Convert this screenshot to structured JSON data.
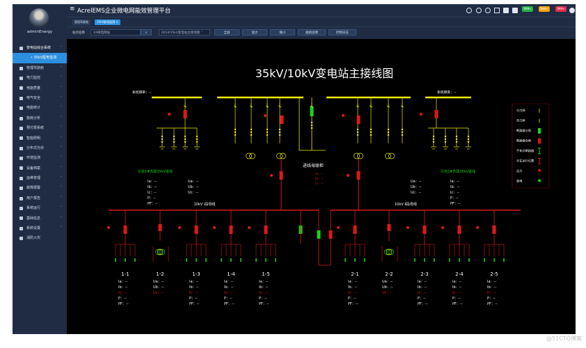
{
  "user": {
    "name": "adminEnergy"
  },
  "header": {
    "title": "AcrelEMS企业微电网能效管理平台",
    "badges": [
      "999+",
      "999+",
      "999+"
    ]
  },
  "tabs": [
    {
      "label": "管理驾驶舱"
    },
    {
      "label": "35kV配电监测"
    }
  ],
  "toolbar": {
    "site_label": "站点名称",
    "site_value": "XX微电网站",
    "diagram_select": "001#35kV变电站主接线图",
    "buttons": [
      "全屏",
      "放大",
      "缩小",
      "规则说明",
      "控制日志"
    ]
  },
  "sidebar": {
    "items": [
      {
        "label": "变电站综合系统",
        "open": true
      },
      {
        "label": "35kV配电监测",
        "sub": true
      },
      {
        "label": "管理驾驶舱"
      },
      {
        "label": "电力监控"
      },
      {
        "label": "电能质量"
      },
      {
        "label": "电气安全"
      },
      {
        "label": "电能统计"
      },
      {
        "label": "能耗分析"
      },
      {
        "label": "预付费系统"
      },
      {
        "label": "智能照明"
      },
      {
        "label": "分布式光伏"
      },
      {
        "label": "环境监测"
      },
      {
        "label": "设备档案"
      },
      {
        "label": "运维管理"
      },
      {
        "label": "故障报警"
      },
      {
        "label": "用户报告"
      },
      {
        "label": "系统运行"
      },
      {
        "label": "基础信息"
      },
      {
        "label": "系统设置"
      },
      {
        "label": "消防火灾"
      }
    ]
  },
  "diagram": {
    "title": "35kV/10kV变电站主接线图",
    "freq_left": "系统频率：--",
    "freq_right": "系统频率：--",
    "incoming_left": "引自1#市政35kV进线",
    "incoming_right": "引自2#市政35kV进线",
    "tie_label": "进线母联柜",
    "bus1": "10kV Ⅰ段母线",
    "bus2": "10kV Ⅱ段母线",
    "feeders_left": [
      "1-1",
      "1-2",
      "1-3",
      "1-4",
      "1-5"
    ],
    "feeders_right": [
      "2-1",
      "2-2",
      "2-3",
      "2-4",
      "2-5"
    ],
    "readings_left": [
      "Ia：--",
      "Ib：--",
      "Ic：--",
      "P：--",
      "PF：--"
    ],
    "readings_volt": [
      "Ua：--",
      "Ub：--",
      "Uc：--"
    ],
    "readings_tie": [
      "Ia：--",
      "Ib：--",
      "Ic：--"
    ],
    "feeder_readings": [
      "Ia：--",
      "Ib：--",
      "Ic：--",
      "P：--",
      "PF：--"
    ],
    "trans_readings": [
      "Ua：--",
      "Ub：--",
      "Uc：--"
    ],
    "legend": [
      {
        "label": "分刀闸",
        "color": "#ffe100"
      },
      {
        "label": "合刀闸",
        "color": "#ffe100"
      },
      {
        "label": "断路器分闸",
        "color": "#19d419"
      },
      {
        "label": "断路器合闸",
        "color": "#e01010"
      },
      {
        "label": "手车式断路器",
        "color": "#19d419"
      },
      {
        "label": "手车运行位置",
        "color": "#e01010"
      },
      {
        "label": "远方",
        "color": "#e01010"
      },
      {
        "label": "就地",
        "color": "#19d419"
      }
    ]
  },
  "watermark": "@51CTO博客",
  "colors": {
    "sidebar": "#1f2c44",
    "accent": "#2d8fe0",
    "bus_yellow": "#f1f100",
    "bus_red": "#e01818",
    "closed": "#e01010",
    "open": "#19d419"
  }
}
